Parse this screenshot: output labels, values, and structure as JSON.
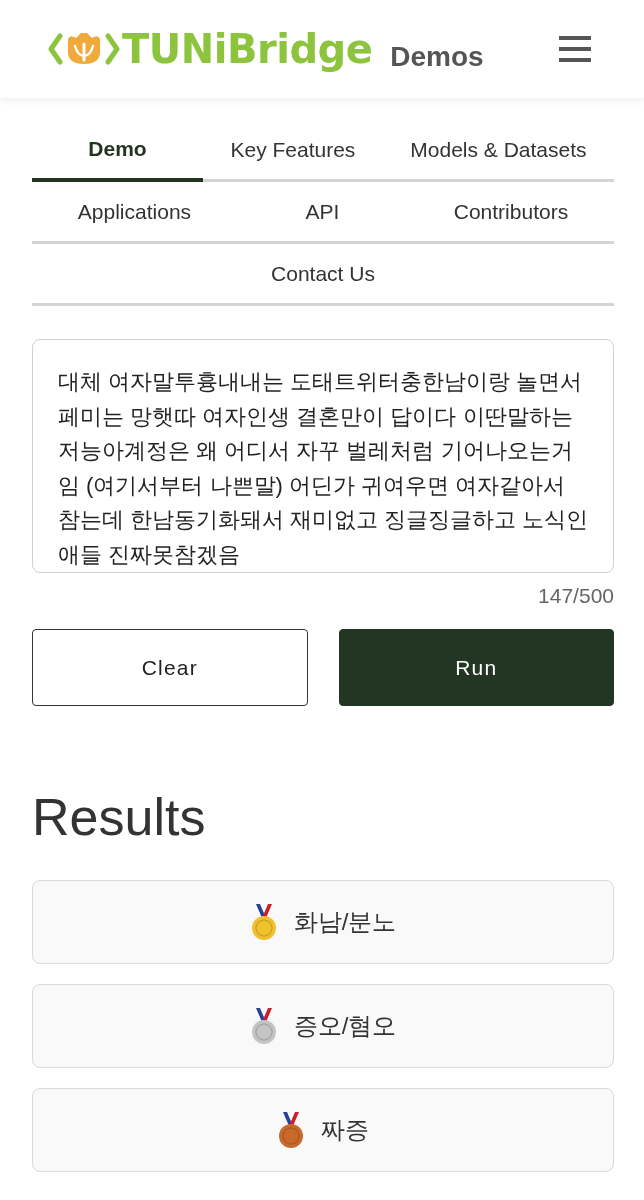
{
  "header": {
    "logo_text": "TUNiBridge",
    "subtitle": "Demos"
  },
  "tabs": [
    {
      "label": "Demo",
      "selected": true
    },
    {
      "label": "Key Features",
      "selected": false
    },
    {
      "label": "Models & Datasets",
      "selected": false
    },
    {
      "label": "Applications",
      "selected": false
    },
    {
      "label": "API",
      "selected": false
    },
    {
      "label": "Contributors",
      "selected": false
    },
    {
      "label": "Contact Us",
      "selected": false
    }
  ],
  "input": {
    "value": "대체 여자말투흉내내는 도태트위터충한남이랑 놀면서 페미는 망햇따 여자인생 결혼만이 답이다 이딴말하는 저능아계정은 왜 어디서 자꾸 벌레처럼 기어나오는거임 (여기서부터 나쁜말) 어딘가 귀여우면 여자같아서 참는데 한남동기화돼서 재미없고 징글징글하고 노식인 애들 진짜못참겠음",
    "counter": "147/500"
  },
  "buttons": [
    {
      "label": "Clear",
      "kind": "secondary"
    },
    {
      "label": "Run",
      "kind": "primary"
    }
  ],
  "results_heading": "Results",
  "results": [
    {
      "label": "화남/분노",
      "color": "#f2c12e"
    },
    {
      "label": "증오/혐오",
      "color": "#c4c4c4"
    },
    {
      "label": "짜증",
      "color": "#c9692c"
    }
  ]
}
